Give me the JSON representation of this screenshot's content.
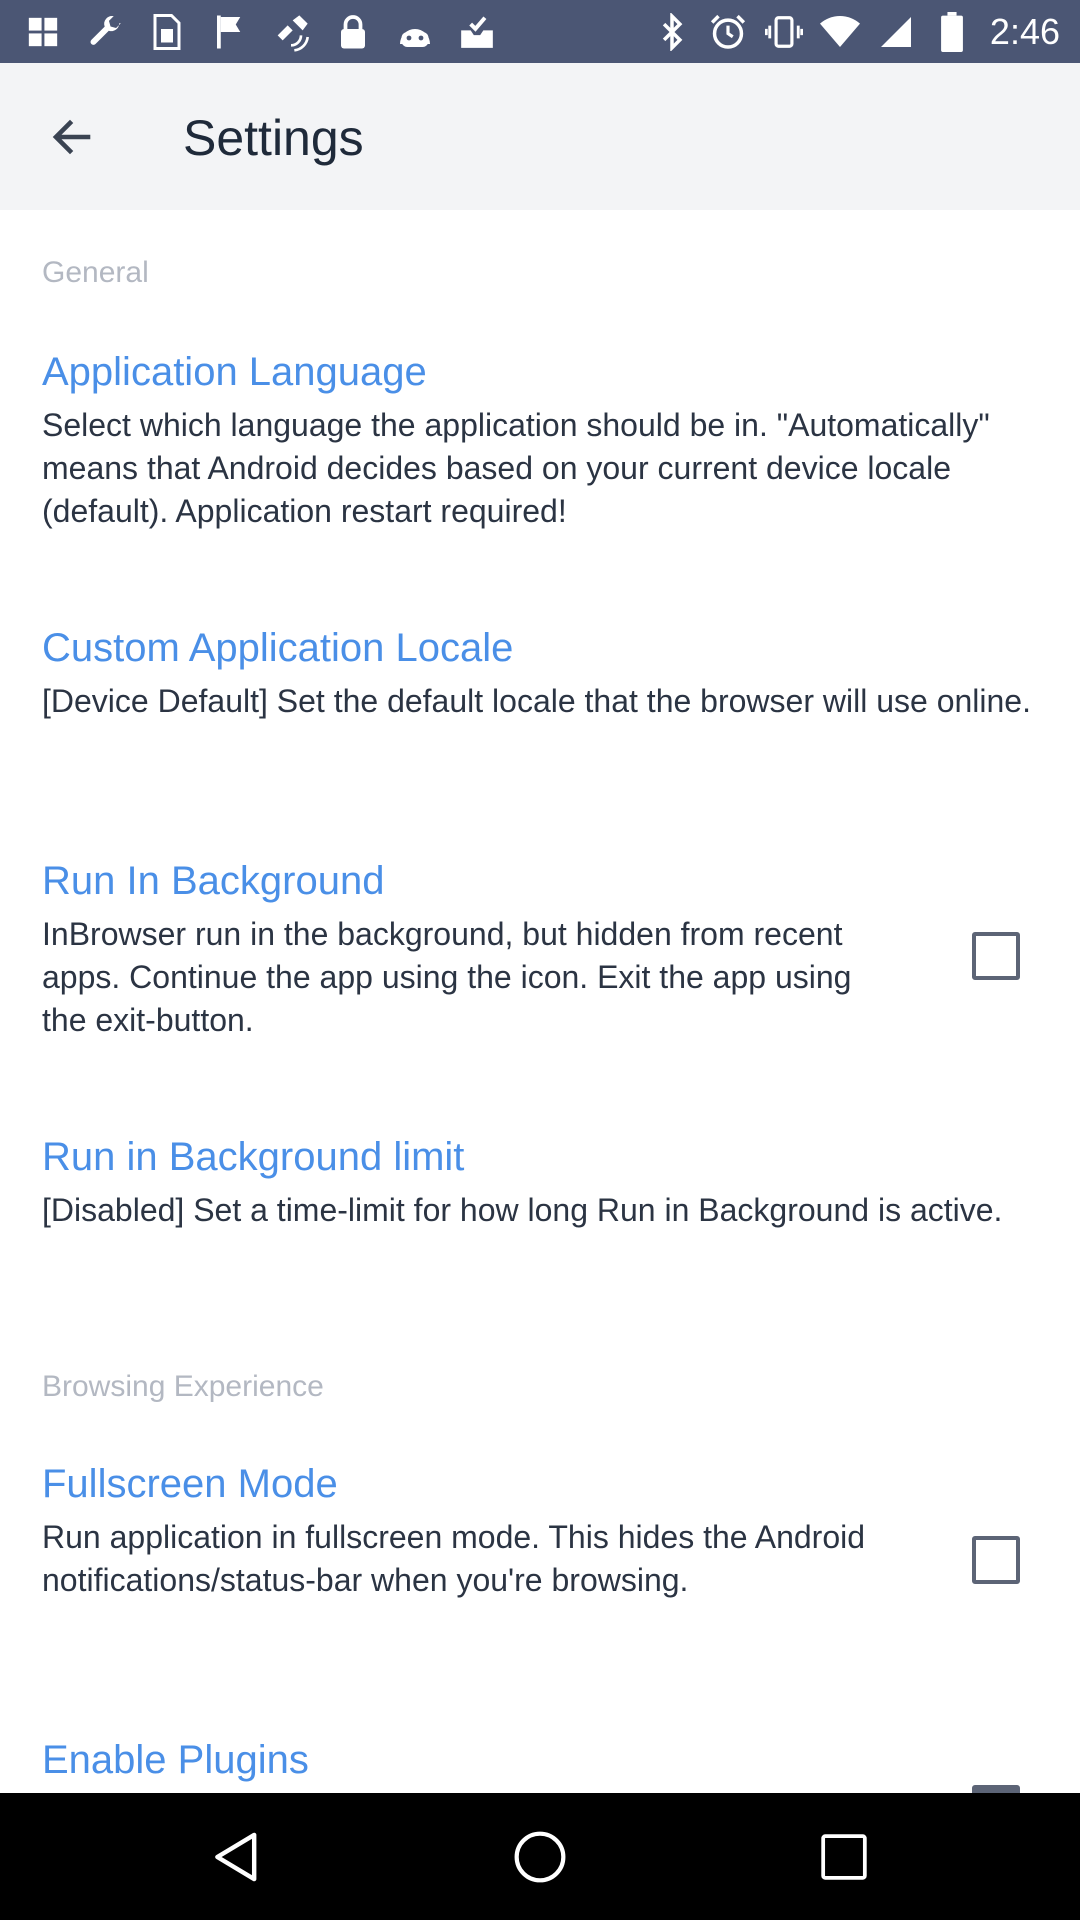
{
  "status_bar": {
    "left_icons": [
      "photos-icon",
      "wrench-icon",
      "sim-card-icon",
      "flag-icon",
      "fake-gps-icon",
      "lock-icon",
      "android-icon",
      "inbox-check-icon"
    ],
    "right_icons": [
      "bluetooth-icon",
      "alarm-icon",
      "vibrate-icon",
      "wifi-icon",
      "signal-icon",
      "battery-icon"
    ],
    "time": "2:46"
  },
  "app_bar": {
    "title": "Settings"
  },
  "sections": {
    "general": {
      "label": "General"
    },
    "browsing": {
      "label": "Browsing Experience"
    }
  },
  "settings": {
    "app_language": {
      "title": "Application Language",
      "description": "Select which language the application should be in. \"Automatically\" means that Android decides based on your current device locale (default). Application restart required!"
    },
    "custom_locale": {
      "title": "Custom Application Locale",
      "description": "[Device Default] Set the default locale that the browser will use online."
    },
    "run_in_background": {
      "title": "Run In Background",
      "description": "InBrowser run in the background, but hidden from recent apps. Continue the app using the icon. Exit the app using the exit-button.",
      "checked": false
    },
    "run_background_limit": {
      "title": "Run in Background limit",
      "description": "[Disabled] Set a time-limit for how long Run in Background is active."
    },
    "fullscreen_mode": {
      "title": "Fullscreen Mode",
      "description": "Run application in fullscreen mode. This hides the Android notifications/status-bar when you're browsing.",
      "checked": false
    },
    "enable_plugins": {
      "title": "Enable Plugins",
      "checked": true
    }
  },
  "nav_bar": {
    "icons": [
      "back-triangle-icon",
      "home-circle-icon",
      "recents-square-icon"
    ]
  },
  "colors": {
    "status_bar_bg": "#4b5674",
    "app_bar_bg": "#f3f4f6",
    "accent": "#4a8fe7",
    "section_header": "#b3b8c2",
    "body_text": "#2b3443"
  }
}
